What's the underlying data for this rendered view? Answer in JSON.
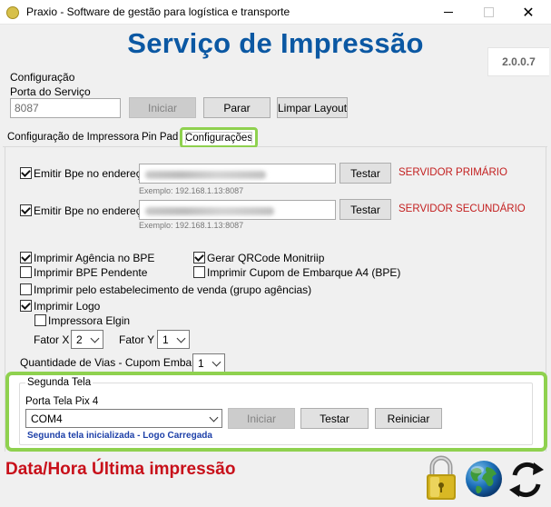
{
  "window": {
    "title": "Praxio - Software de gestão para logística e transporte",
    "app_icon": "praxio-app-icon"
  },
  "header": {
    "main_title": "Serviço de Impressão",
    "version": "2.0.0.7"
  },
  "configuracao": {
    "section_label": "Configuração",
    "port_label": "Porta do Serviço",
    "port_value": "8087",
    "iniciar_label": "Iniciar",
    "parar_label": "Parar",
    "limpar_label": "Limpar Layout"
  },
  "tabs": [
    {
      "label": "Configuração de Impressora",
      "active": false
    },
    {
      "label": "Pin Pad",
      "active": false
    },
    {
      "label": "Configurações",
      "active": true
    }
  ],
  "servers": [
    {
      "checkbox_label": "Emitir Bpe no endereço:",
      "checked": true,
      "example": "Exemplo: 192.168.1.13:8087",
      "test_label": "Testar",
      "server_label": "SERVIDOR PRIMÁRIO"
    },
    {
      "checkbox_label": "Emitir Bpe no endereço:",
      "checked": true,
      "example": "Exemplo: 192.168.1.13:8087",
      "test_label": "Testar",
      "server_label": "SERVIDOR SECUNDÁRIO"
    }
  ],
  "options": {
    "imprimir_agencia": {
      "label": "Imprimir Agência no BPE",
      "checked": true
    },
    "gerar_qrcode": {
      "label": "Gerar QRCode Monitriip",
      "checked": true
    },
    "imprimir_pendente": {
      "label": "Imprimir BPE Pendente",
      "checked": false
    },
    "imprimir_cupom": {
      "label": "Imprimir Cupom de Embarque A4 (BPE)",
      "checked": false
    },
    "imprimir_estabelecimento": {
      "label": "Imprimir pelo estabelecimento de venda (grupo agências)",
      "checked": false
    },
    "imprimir_logo": {
      "label": "Imprimir Logo",
      "checked": true
    },
    "impressora_elgin": {
      "label": "Impressora Elgin",
      "checked": false
    }
  },
  "fatores": {
    "fator_x_label": "Fator X",
    "fator_x_value": "2",
    "fator_y_label": "Fator Y",
    "fator_y_value": "1",
    "vias_label": "Quantidade de Vias - Cupom Embarque",
    "vias_value": "1"
  },
  "segunda_tela": {
    "group_title": "Segunda Tela",
    "port_label": "Porta Tela Pix 4",
    "port_value": "COM4",
    "iniciar_label": "Iniciar",
    "testar_label": "Testar",
    "reiniciar_label": "Reiniciar",
    "status": "Segunda tela inicializada - Logo Carregada"
  },
  "footer": {
    "last_print_label": "Data/Hora Última impressão"
  },
  "colors": {
    "title_blue": "#0b58a3",
    "highlight_green": "#8fd14f",
    "server_red": "#c31f1f",
    "status_blue": "#1c3fa8",
    "footer_red": "#c8101a"
  }
}
